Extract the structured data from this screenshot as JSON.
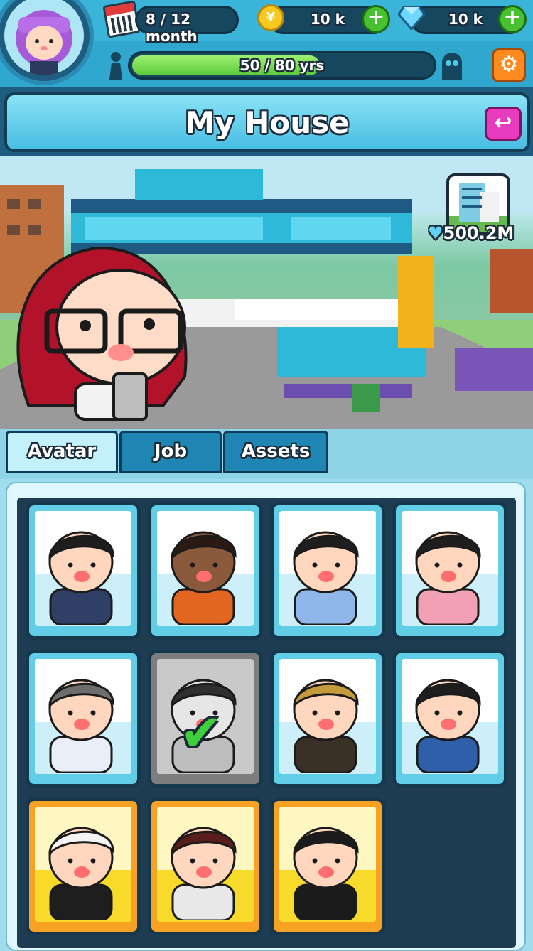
{
  "hud": {
    "month_progress": "8 / 12 month",
    "coins": "10 k",
    "gems": "10 k",
    "age_progress_text": "50 / 80 yrs",
    "age_progress_fraction": 0.625,
    "add_symbol": "+",
    "coin_symbol": "¥",
    "settings_icon": "gear-icon",
    "back_icon": "back-arrow-icon"
  },
  "page": {
    "title": "My House"
  },
  "scene": {
    "asset_value": "500.2M",
    "asset_thumbnail": "apartment-building-icon"
  },
  "tabs": [
    {
      "label": "Avatar",
      "active": true
    },
    {
      "label": "Job",
      "active": false
    },
    {
      "label": "Assets",
      "active": false
    }
  ],
  "avatars": [
    {
      "name": "businessman",
      "rarity": "common",
      "selected": false
    },
    {
      "name": "woman-orange-vest",
      "rarity": "common",
      "selected": false
    },
    {
      "name": "man-blue-shirt",
      "rarity": "common",
      "selected": false
    },
    {
      "name": "man-pink-shirt",
      "rarity": "common",
      "selected": false
    },
    {
      "name": "welder",
      "rarity": "common",
      "selected": false
    },
    {
      "name": "red-haired-woman",
      "rarity": "common",
      "selected": true
    },
    {
      "name": "carpenter",
      "rarity": "common",
      "selected": false
    },
    {
      "name": "photographer",
      "rarity": "common",
      "selected": false
    },
    {
      "name": "scientist",
      "rarity": "gold",
      "selected": false
    },
    {
      "name": "chef",
      "rarity": "gold",
      "selected": false
    },
    {
      "name": "ninja",
      "rarity": "gold",
      "selected": false
    }
  ],
  "colors": {
    "accent": "#3ab4d8",
    "gold": "#f8a224",
    "plus_green": "#47c130",
    "settings_orange": "#ff8b1f",
    "back_pink": "#e93bbd"
  }
}
